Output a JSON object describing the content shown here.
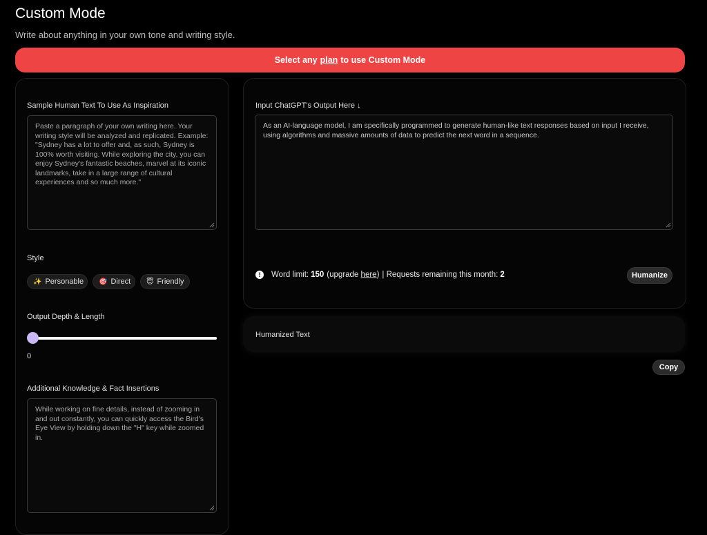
{
  "page": {
    "title": "Custom Mode",
    "subtitle": "Write about anything in your own tone and writing style."
  },
  "banner": {
    "prefix": "Select any",
    "link": "plan",
    "suffix": "to use Custom Mode",
    "color": "#ef4444"
  },
  "left": {
    "sample_label": "Sample Human Text To Use As Inspiration",
    "sample_placeholder": "Paste a paragraph of your own writing here. Your writing style will be analyzed and replicated. Example: \"Sydney has a lot to offer and, as such, Sydney is 100% worth visiting. While exploring the city, you can enjoy Sydney's fantastic beaches, marvel at its iconic landmarks, take in a large range of cultural experiences and so much more.\"",
    "style_label": "Style",
    "styles": [
      {
        "emoji": "✨",
        "label": "Personable"
      },
      {
        "emoji": "🎯",
        "label": "Direct"
      },
      {
        "emoji": "😇",
        "label": "Friendly"
      }
    ],
    "depth_label": "Output Depth & Length",
    "depth_value": "0",
    "knowledge_label": "Additional Knowledge & Fact Insertions",
    "knowledge_placeholder": "While working on fine details, instead of zooming in and out constantly, you can quickly access the Bird's Eye View by holding down the \"H\" key while zoomed in."
  },
  "right": {
    "input_label": "Input ChatGPT's Output Here ↓",
    "input_value": "As an AI-language model, I am specifically programmed to generate human-like text responses based on input I receive, using algorithms and massive amounts of data to predict the next word in a sequence.",
    "word_limit_label": "Word limit:",
    "word_limit": "150",
    "upgrade_prefix": "(upgrade",
    "upgrade_link": "here",
    "upgrade_suffix": ")",
    "requests_label": "| Requests remaining this month:",
    "requests_remaining": "2",
    "humanize_button": "Humanize",
    "humanized_label": "Humanized Text",
    "copy_button": "Copy"
  }
}
